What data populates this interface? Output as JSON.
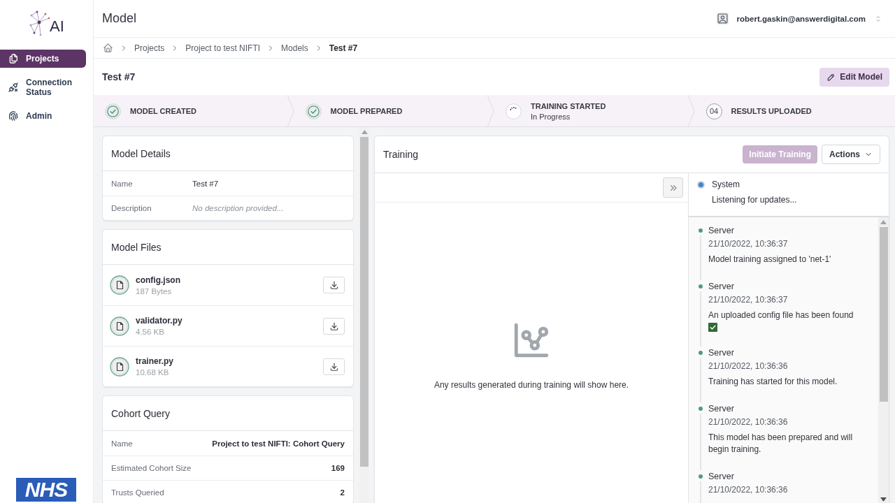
{
  "sidebar": {
    "logo_text": "AI",
    "items": [
      {
        "label": "Projects",
        "selected": true
      },
      {
        "label": "Connection Status",
        "selected": false
      },
      {
        "label": "Admin",
        "selected": false
      }
    ],
    "footer_logo_text": "NHS"
  },
  "header": {
    "title": "Model",
    "user_email": "robert.gaskin@answerdigital.com"
  },
  "breadcrumb": [
    {
      "label": "Projects",
      "current": false
    },
    {
      "label": "Project to test NIFTI",
      "current": false
    },
    {
      "label": "Models",
      "current": false
    },
    {
      "label": "Test #7",
      "current": true
    }
  ],
  "page": {
    "title": "Test #7",
    "edit_button": "Edit Model"
  },
  "steps": [
    {
      "label": "MODEL CREATED",
      "kind": "done"
    },
    {
      "label": "MODEL PREPARED",
      "kind": "done"
    },
    {
      "label": "TRAINING STARTED",
      "sublabel": "In Progress",
      "kind": "in_progress"
    },
    {
      "label": "RESULTS UPLOADED",
      "kind": "pending",
      "number": "04"
    }
  ],
  "model_details": {
    "title": "Model Details",
    "rows": [
      {
        "label": "Name",
        "value": "Test #7",
        "kind": "value"
      },
      {
        "label": "Description",
        "value": "No description provided...",
        "kind": "empty"
      }
    ]
  },
  "model_files": {
    "title": "Model Files",
    "files": [
      {
        "name": "config.json",
        "size": "187 Bytes"
      },
      {
        "name": "validator.py",
        "size": "4.56 KB"
      },
      {
        "name": "trainer.py",
        "size": "10.68 KB"
      }
    ]
  },
  "cohort_query": {
    "title": "Cohort Query",
    "rows": [
      {
        "label": "Name",
        "value": "Project to test NIFTI: Cohort Query"
      },
      {
        "label": "Estimated Cohort Size",
        "value": "169"
      },
      {
        "label": "Trusts Queried",
        "value": "2"
      }
    ]
  },
  "training": {
    "title": "Training",
    "initiate_button": {
      "label": "Initiate Training",
      "disabled": true
    },
    "actions_button": "Actions",
    "empty_message": "Any results generated during training will show here.",
    "system": {
      "source": "System",
      "message": "Listening for updates..."
    },
    "log": [
      {
        "source": "Server",
        "time": "21/10/2022, 10:36:37",
        "message": "Model training assigned to 'net-1'",
        "tick": false
      },
      {
        "source": "Server",
        "time": "21/10/2022, 10:36:37",
        "message": "An uploaded config file has been found",
        "tick": true
      },
      {
        "source": "Server",
        "time": "21/10/2022, 10:36:36",
        "message": "Training has started for this model.",
        "tick": false
      },
      {
        "source": "Server",
        "time": "21/10/2022, 10:36:36",
        "message": "This model has been prepared and will begin training.",
        "tick": false
      },
      {
        "source": "Server",
        "time": "21/10/2022, 10:36:36",
        "tick": false
      }
    ]
  }
}
